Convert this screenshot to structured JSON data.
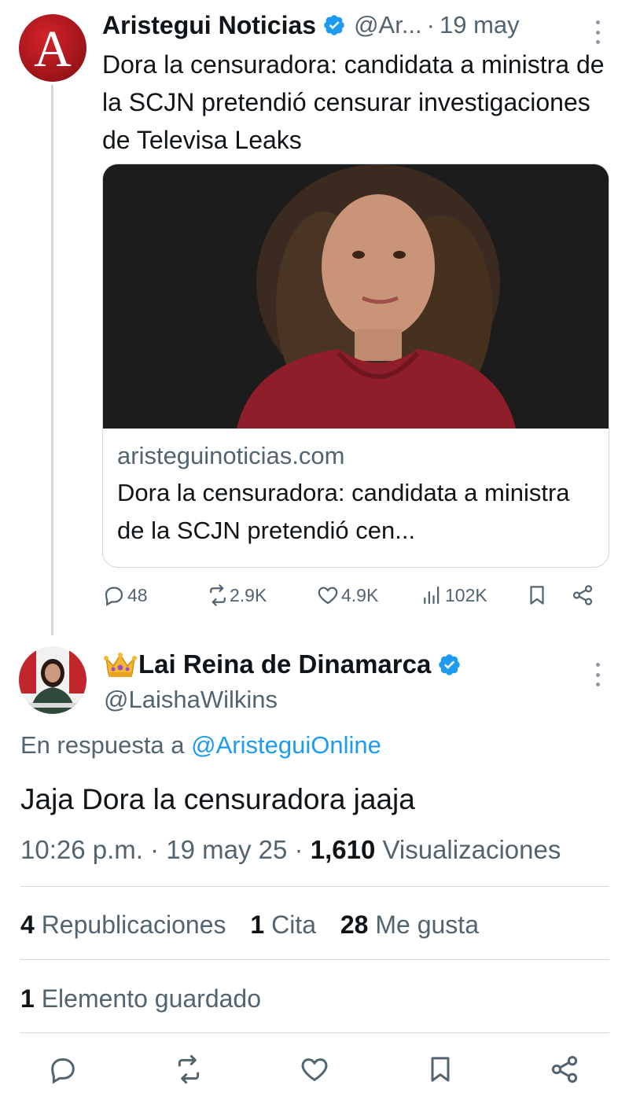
{
  "original_tweet": {
    "author_name": "Aristegui Noticias",
    "handle": "@Ar...",
    "separator": "·",
    "date": "19 may",
    "text": "Dora la censuradora: candidata a ministra de la SCJN pretendió censurar investigaciones de Televisa Leaks",
    "card": {
      "domain": "aristeguinoticias.com",
      "title": "Dora la censuradora: candidata a ministra de la SCJN pretendió cen..."
    },
    "metrics": {
      "replies": "48",
      "reposts": "2.9K",
      "likes": "4.9K",
      "views": "102K"
    }
  },
  "reply_tweet": {
    "author_name": "Lai Reina de Dinamarca",
    "handle": "@LaishaWilkins",
    "reply_to_prefix": "En respuesta a",
    "reply_to_mention": "@AristeguiOnline",
    "text": "Jaja Dora la censuradora jaaja",
    "time": "10:26 p.m.",
    "separator": "·",
    "date": "19 may 25",
    "views_count": "1,610",
    "views_label": "Visualizaciones",
    "stats": {
      "reposts_count": "4",
      "reposts_label": "Republicaciones",
      "quotes_count": "1",
      "quotes_label": "Cita",
      "likes_count": "28",
      "likes_label": "Me gusta",
      "bookmarks_count": "1",
      "bookmarks_label": "Elemento guardado"
    }
  },
  "colors": {
    "text_primary": "#0f1419",
    "text_secondary": "#536471",
    "link": "#1d9bf0",
    "verified": "#1d9bf0",
    "divider": "#cfd9de",
    "brand_red": "#c21d23"
  },
  "icons": [
    "kebab-icon",
    "verified-badge-icon",
    "reply-icon",
    "repost-icon",
    "like-icon",
    "views-icon",
    "bookmark-icon",
    "share-icon",
    "crown-emoji-icon"
  ]
}
